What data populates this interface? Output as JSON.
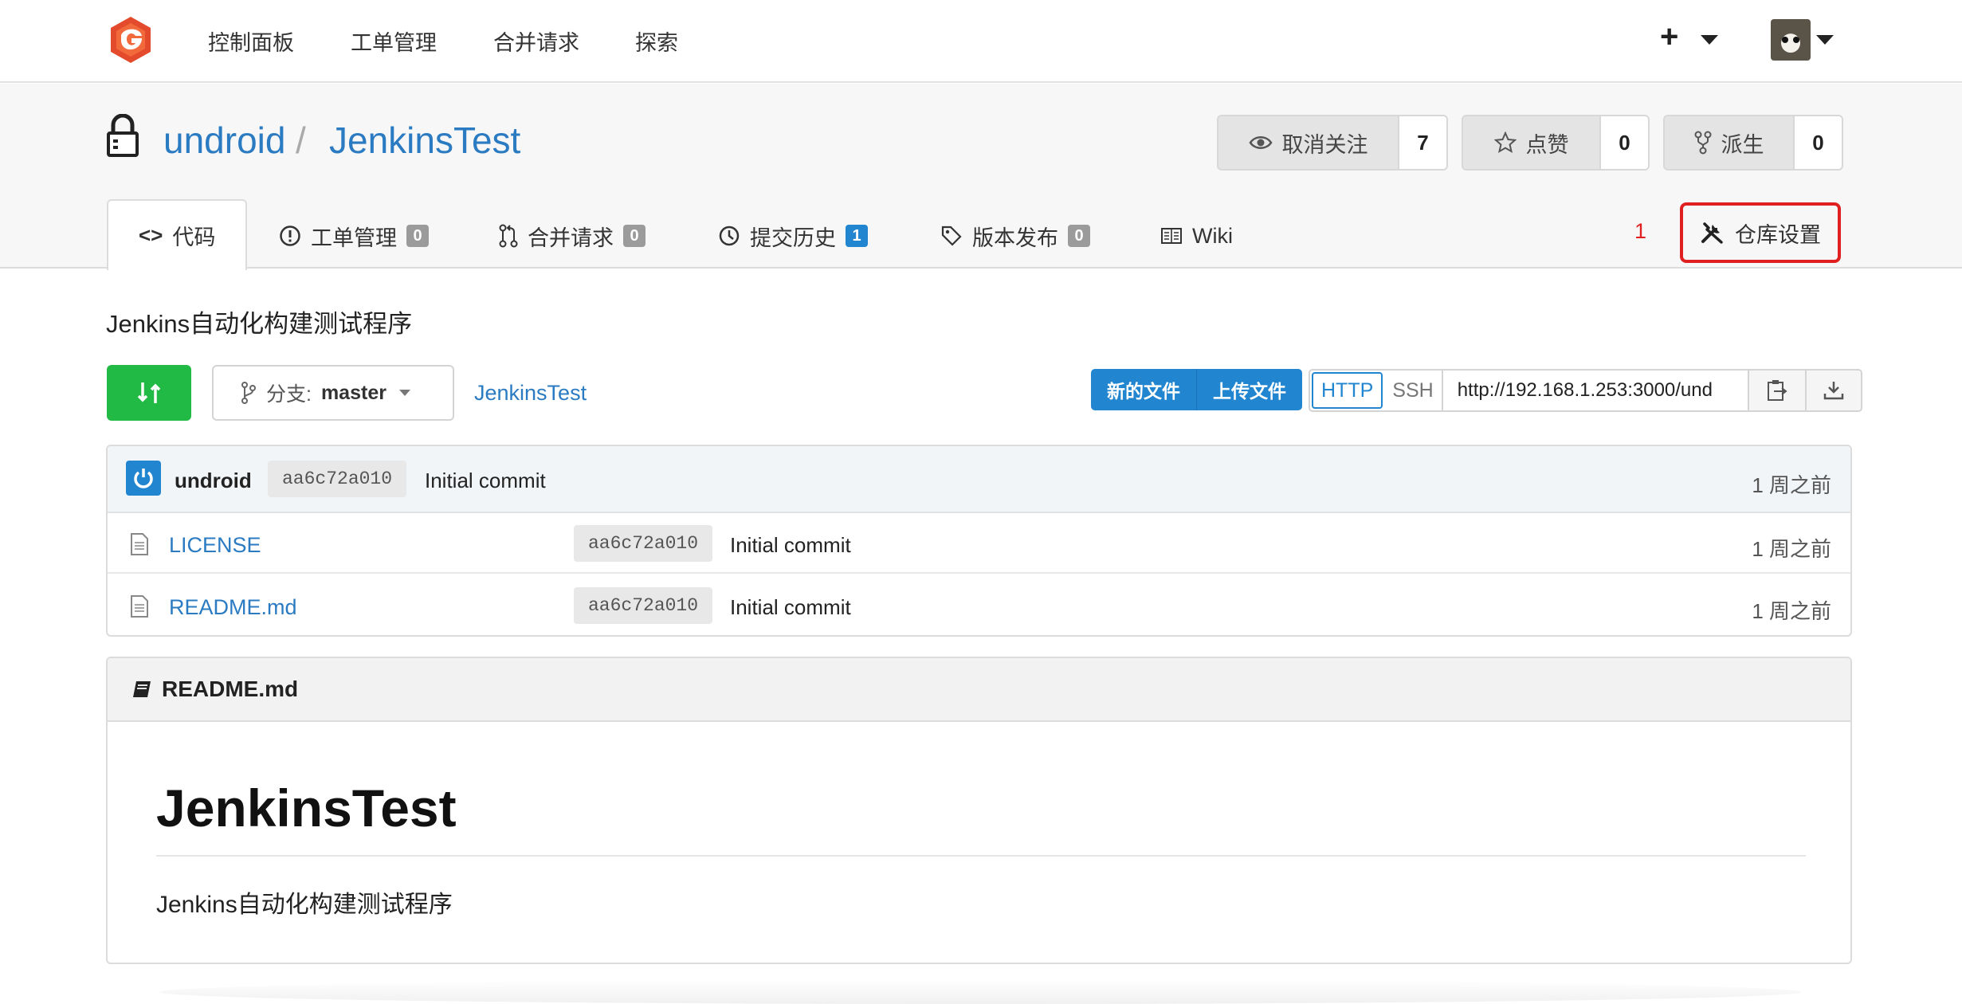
{
  "nav": {
    "links": [
      "控制面板",
      "工单管理",
      "合并请求",
      "探索"
    ],
    "plus": "+"
  },
  "repo": {
    "owner": "undroid",
    "separator": "/",
    "name": "JenkinsTest",
    "watch": {
      "label": "取消关注",
      "count": "7"
    },
    "star": {
      "label": "点赞",
      "count": "0"
    },
    "fork": {
      "label": "派生",
      "count": "0"
    },
    "description": "Jenkins自动化构建测试程序"
  },
  "tabs": [
    {
      "label": "代码"
    },
    {
      "label": "工单管理",
      "badge": "0"
    },
    {
      "label": "合并请求",
      "badge": "0"
    },
    {
      "label": "提交历史",
      "badge": "1"
    },
    {
      "label": "版本发布",
      "badge": "0"
    },
    {
      "label": "Wiki"
    }
  ],
  "settings": {
    "label": "仓库设置",
    "annotation": "1"
  },
  "toolbar": {
    "branch_prefix": "分支:",
    "branch": "master",
    "repo_link": "JenkinsTest",
    "new_file": "新的文件",
    "upload_file": "上传文件",
    "http": "HTTP",
    "ssh": "SSH",
    "clone_url": "http://192.168.1.253:3000/und"
  },
  "latest_commit": {
    "author": "undroid",
    "sha": "aa6c72a010",
    "message": "Initial commit",
    "age": "1 周之前"
  },
  "files": [
    {
      "name": "LICENSE",
      "sha": "aa6c72a010",
      "message": "Initial commit",
      "age": "1 周之前"
    },
    {
      "name": "README.md",
      "sha": "aa6c72a010",
      "message": "Initial commit",
      "age": "1 周之前"
    }
  ],
  "readme": {
    "filename": "README.md",
    "title": "JenkinsTest",
    "body": "Jenkins自动化构建测试程序"
  },
  "colors": {
    "link": "#2b7bc2",
    "primary": "#2185d0",
    "success": "#21ba45",
    "highlight": "#e02020"
  }
}
